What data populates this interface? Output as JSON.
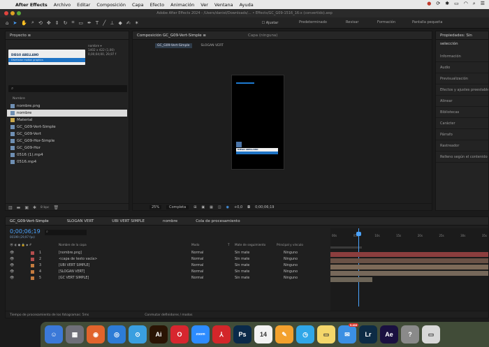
{
  "menubar": {
    "items": [
      "After Effects",
      "Archivo",
      "Editar",
      "Composición",
      "Capa",
      "Efecto",
      "Animación",
      "Ver",
      "Ventana",
      "Ayuda"
    ]
  },
  "title": "Adobe After Effects 2024 - /Users/daniel/Downloads/... • Effects/GC_G09-1516_16:x (convertido).aep",
  "toolbar": {
    "workspaces": [
      "Predeterminado",
      "Revisar",
      "Formación",
      "Pantalla pequeña"
    ]
  },
  "project": {
    "tab": "Proyecto ≡",
    "thumb_info": "nombre ▾\n1402 x 422 (1,00)\n0,00;04;00, 29,97 f",
    "thumb_name": "DIEGO ABELLANO",
    "thumb_sub": "Diseñador motion graphics",
    "search_placeholder": "⌕",
    "col_name": "Nombre",
    "items": [
      {
        "name": "nombre.png",
        "color": "#c9c9c9",
        "selected": false
      },
      {
        "name": "nombre",
        "color": "#c9c9c9",
        "selected": true
      },
      {
        "name": "Material",
        "color": "#c9c9c9",
        "selected": false
      },
      {
        "name": "GC_G09-Vert-Simple",
        "color": "#c9c9c9",
        "selected": false
      },
      {
        "name": "GC_G09-Vert",
        "color": "#c9c9c9",
        "selected": false
      },
      {
        "name": "GC_G09-Hor-Simple",
        "color": "#c9c9c9",
        "selected": false
      },
      {
        "name": "GC_G09-Hor",
        "color": "#c9c9c9",
        "selected": false
      },
      {
        "name": "0516 (1).mp4",
        "color": "#c9c9c9",
        "selected": false
      },
      {
        "name": "0516.mp4",
        "color": "#c9c9c9",
        "selected": false
      }
    ],
    "bpc": "8 bpc"
  },
  "comp": {
    "tab": "Composición GC_G09-Vert-Simple ≡",
    "layer_tab": "Capa (ninguna)",
    "subtabs": [
      "GC_G09-Vert-Simple",
      "SLOGAN VERT"
    ],
    "zoom": "25%",
    "quality": "Completa",
    "exposure": "+0,0",
    "timecode": "0;00;06;19",
    "name_card": "DIEGO ABELLANO"
  },
  "props": {
    "tab": "Propiedades: Sin selección",
    "rows": [
      "Información",
      "Audio",
      "Previsualización",
      "Efectos y ajustes preestablecidos",
      "Alinear",
      "Bibliotecas",
      "Carácter",
      "Párrafo",
      "Rastreador",
      "Relleno según el contenido"
    ]
  },
  "timeline": {
    "tabs": [
      "GC_G09-Vert-Simple",
      "SLOGAN VERT",
      "UBI VERT SIMPLE",
      "nombre",
      "Cola de procesamiento"
    ],
    "timecode": "0;00;06;19",
    "fps": "00199 (29,97 fps)",
    "headers": [
      "Nombre de la capa",
      "Modo",
      "T",
      "Mate de seguimiento",
      "Principal y vínculo"
    ],
    "layers": [
      {
        "num": "1",
        "name": "[nombre.png]",
        "color": "#b34d4d",
        "mode": "Normal",
        "matte": "Sin mate",
        "parent": "Ninguno"
      },
      {
        "num": "2",
        "name": "<capa de texto vacía>",
        "color": "#b34d4d",
        "mode": "Normal",
        "matte": "Sin mate",
        "parent": "Ninguno"
      },
      {
        "num": "3",
        "name": "[UBI VERT SIMPLE]",
        "color": "#c47b3f",
        "mode": "Normal",
        "matte": "Sin mate",
        "parent": "Ninguno"
      },
      {
        "num": "4",
        "name": "[SLOGAN VERT]",
        "color": "#c47b3f",
        "mode": "Normal",
        "matte": "Sin mate",
        "parent": "Ninguno"
      },
      {
        "num": "5",
        "name": "[GC VERT SIMPLE]",
        "color": "#c47b3f",
        "mode": "Normal",
        "matte": "Sin mate",
        "parent": "Ninguno"
      }
    ],
    "ruler": [
      "00s",
      "05s",
      "10s",
      "15s",
      "20s",
      "25s",
      "30s",
      "35s"
    ],
    "footer_left": "Tiempo de procesamiento de los fotogramas: 5ms",
    "footer_mid": "Conmutar definidores / modos"
  },
  "dock": {
    "apps": [
      {
        "label": "☺",
        "bg": "#3b79d8",
        "name": "finder-icon"
      },
      {
        "label": "▦",
        "bg": "#6f6f78",
        "name": "launchpad-icon"
      },
      {
        "label": "◉",
        "bg": "#e1642c",
        "name": "firefox-icon"
      },
      {
        "label": "◎",
        "bg": "#2d7cd6",
        "name": "calendar-app-icon"
      },
      {
        "label": "⊙",
        "bg": "#3a9fe0",
        "name": "safari-icon"
      },
      {
        "label": "Ai",
        "bg": "#2a1404",
        "name": "illustrator-icon"
      },
      {
        "label": "O",
        "bg": "#d7262f",
        "name": "opera-icon"
      },
      {
        "label": "zoom",
        "bg": "#2d8cff",
        "name": "zoom-icon"
      },
      {
        "label": "⅄",
        "bg": "#d3262a",
        "name": "acrobat-icon"
      },
      {
        "label": "Ps",
        "bg": "#0a2a4a",
        "name": "photoshop-icon"
      },
      {
        "label": "14",
        "bg": "#f2f2f2",
        "name": "calendar-icon"
      },
      {
        "label": "✎",
        "bg": "#f3a12d",
        "name": "pencil-app-icon"
      },
      {
        "label": "◷",
        "bg": "#30a7e8",
        "name": "clock-app-icon"
      },
      {
        "label": "▭",
        "bg": "#f4d76b",
        "name": "notes-icon"
      },
      {
        "label": "✉",
        "bg": "#3b8fe3",
        "name": "mail-icon"
      },
      {
        "label": "Lr",
        "bg": "#0d2b45",
        "name": "lightroom-icon"
      },
      {
        "label": "Ae",
        "bg": "#1a1040",
        "name": "after-effects-icon"
      },
      {
        "label": "?",
        "bg": "#8a8a8a",
        "name": "help-icon"
      },
      {
        "label": "▭",
        "bg": "#d8d8d8",
        "name": "trash-icon"
      }
    ],
    "mail_badge": "5.468"
  }
}
